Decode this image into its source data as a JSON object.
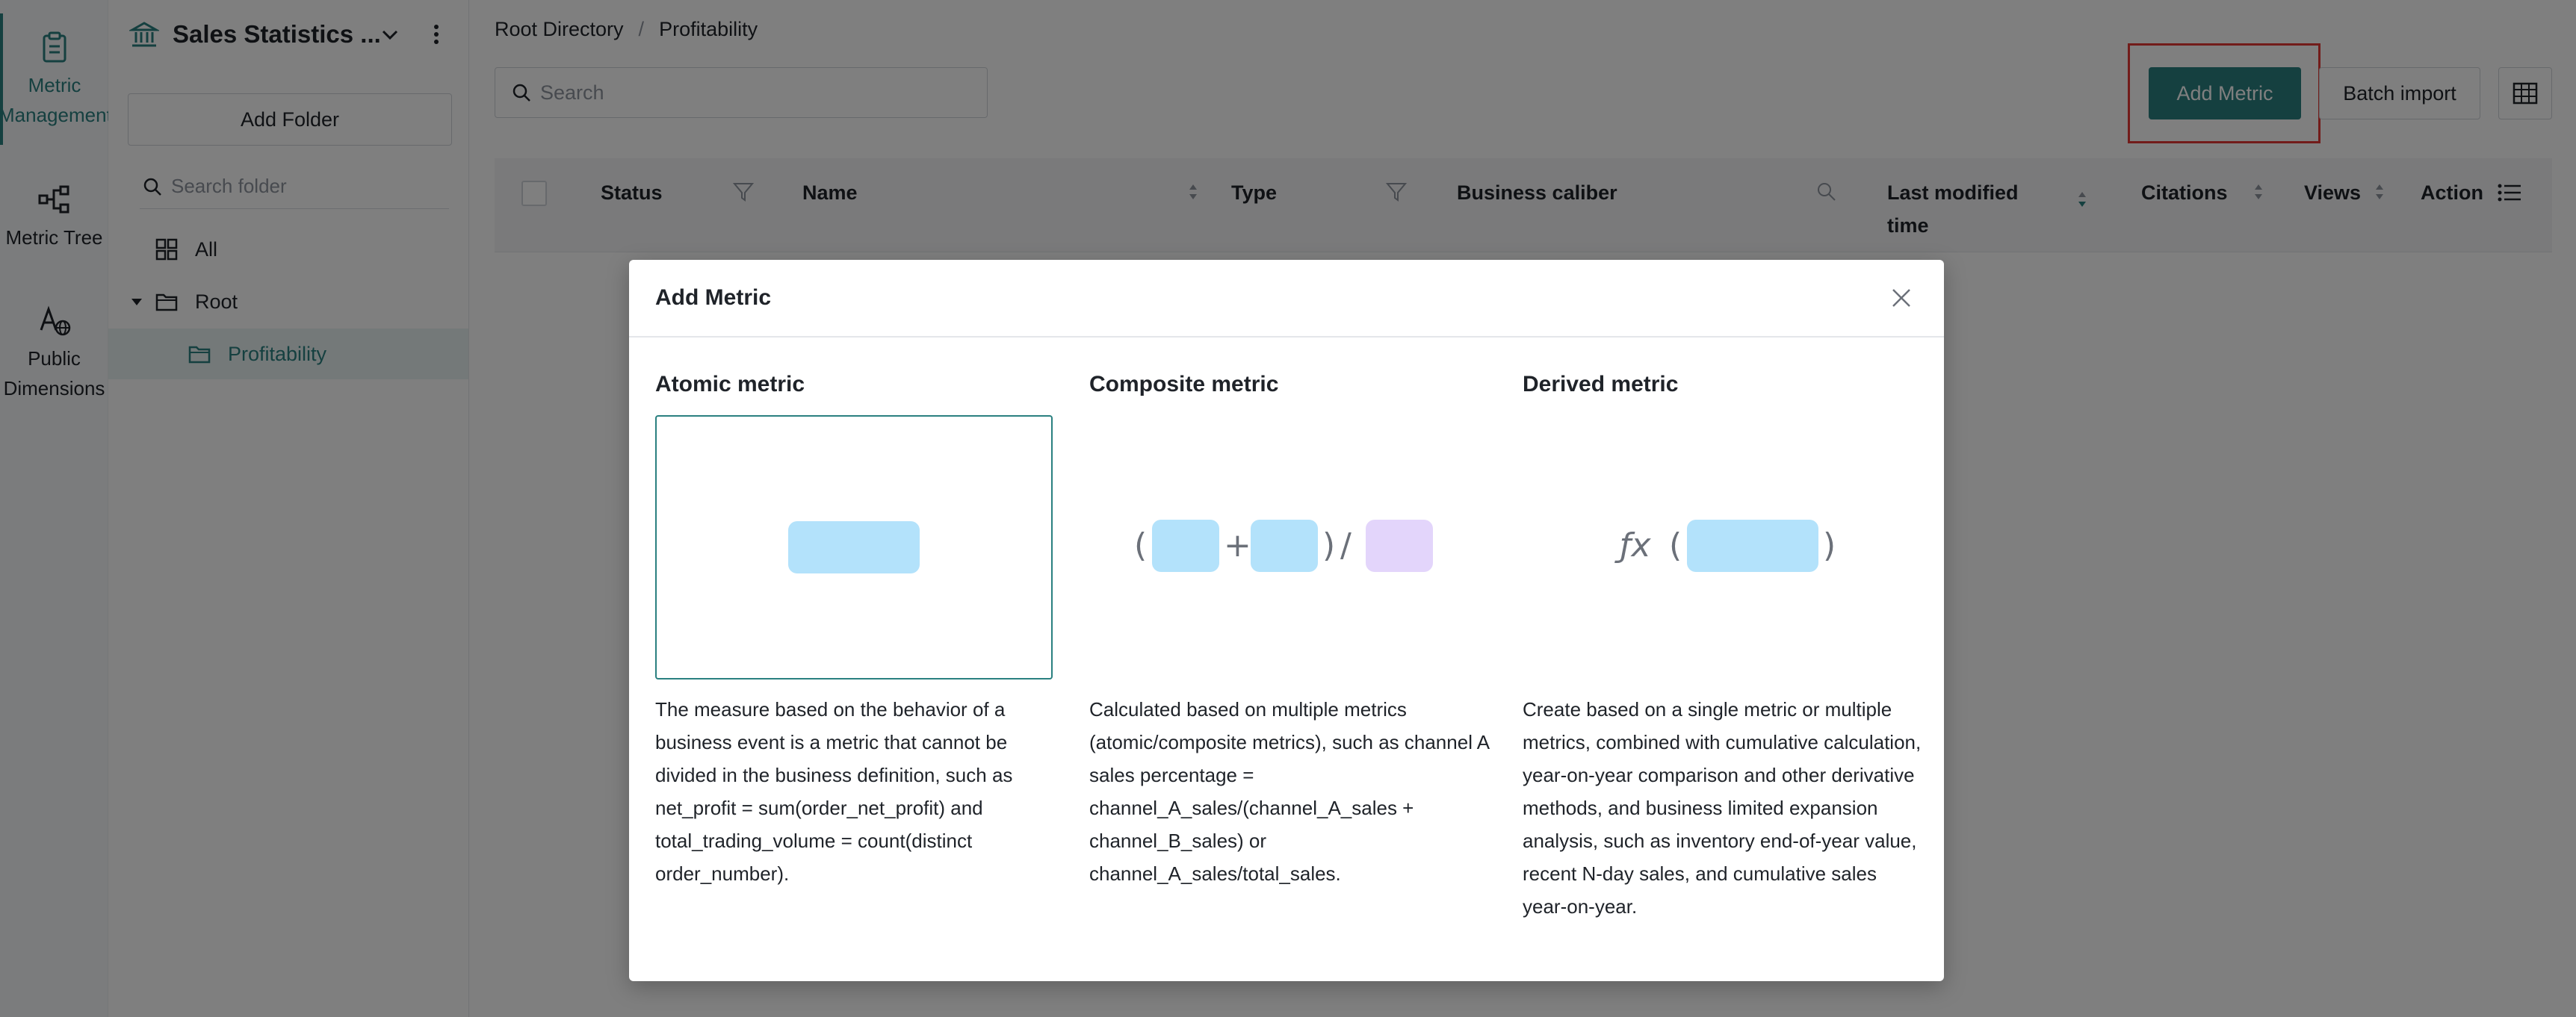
{
  "rail": {
    "items": [
      {
        "label": "Metric Management",
        "icon": "clipboard-icon",
        "active": true
      },
      {
        "label": "Metric Tree",
        "icon": "tree-icon",
        "active": false
      },
      {
        "label": "Public Dimensions",
        "icon": "dimension-globe-icon",
        "active": false
      }
    ]
  },
  "panel": {
    "workspace_title": "Sales Statistics ...",
    "add_folder_label": "Add Folder",
    "search_placeholder": "Search folder",
    "tree": [
      {
        "label": "All",
        "icon": "grid-icon"
      },
      {
        "label": "Root",
        "icon": "folder-icon"
      },
      {
        "label": "Profitability",
        "icon": "folder-icon"
      }
    ]
  },
  "main": {
    "breadcrumb": [
      "Root Directory",
      "Profitability"
    ],
    "search_placeholder": "Search",
    "add_metric_label": "Add Metric",
    "batch_import_label": "Batch import",
    "columns": {
      "status": "Status",
      "name": "Name",
      "type": "Type",
      "business_caliber": "Business caliber",
      "last_modified_line1": "Last modified",
      "last_modified_line2": "time",
      "citations": "Citations",
      "views": "Views",
      "action": "Action"
    }
  },
  "modal": {
    "title": "Add Metric",
    "options": [
      {
        "title": "Atomic metric",
        "selected": true,
        "description": "The measure based on the behavior of a business event is a metric that cannot be divided in the business definition, such as net_profit = sum(order_net_profit) and total_trading_volume = count(distinct order_number)."
      },
      {
        "title": "Composite metric",
        "selected": false,
        "description": "Calculated based on multiple metrics (atomic/composite metrics), such as channel A sales percentage = channel_A_sales/(channel_A_sales + channel_B_sales) or channel_A_sales/total_sales."
      },
      {
        "title": "Derived metric",
        "selected": false,
        "description": "Create based on a single metric or multiple metrics, combined with cumulative calculation, year-on-year comparison and other derivative methods, and business limited expansion analysis, such as inventory end-of-year value, recent N-day sales, and cumulative sales year-on-year."
      }
    ],
    "glyphs": {
      "open_paren": "(",
      "close_paren": ")",
      "plus": "+",
      "divide": "/",
      "fx": "ƒx"
    }
  },
  "colors": {
    "accent": "#2a8080",
    "highlight": "#e53935",
    "pill_blue": "#b3e2fb",
    "pill_purple": "#e3d5fb"
  }
}
